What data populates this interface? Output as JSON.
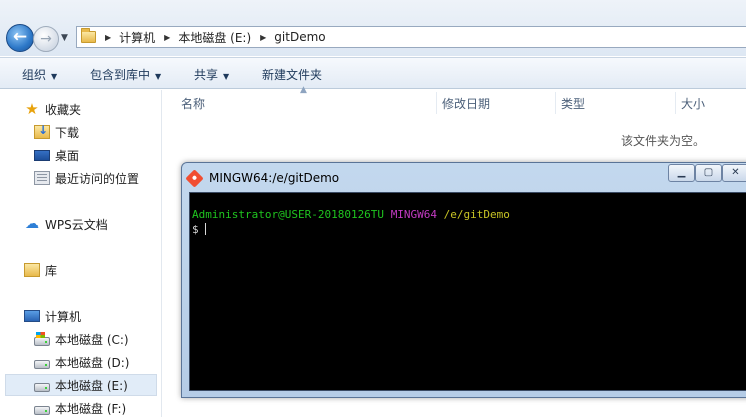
{
  "address": {
    "crumbs": [
      "计算机",
      "本地磁盘 (E:)",
      "gitDemo"
    ]
  },
  "toolbar": {
    "organize": "组织",
    "include_in_library": "包含到库中",
    "share": "共享",
    "new_folder": "新建文件夹"
  },
  "nav": {
    "favorites": "收藏夹",
    "downloads": "下载",
    "desktop": "桌面",
    "recent": "最近访问的位置",
    "wps_cloud": "WPS云文档",
    "libraries": "库",
    "computer": "计算机",
    "drive_c": "本地磁盘 (C:)",
    "drive_d": "本地磁盘 (D:)",
    "drive_e": "本地磁盘 (E:)",
    "drive_f": "本地磁盘 (F:)"
  },
  "file_list": {
    "columns": [
      "名称",
      "修改日期",
      "类型",
      "大小"
    ],
    "empty_message": "该文件夹为空。"
  },
  "terminal": {
    "title": "MINGW64:/e/gitDemo",
    "prompt_user": "Administrator@USER-20180126TU",
    "prompt_env": "MINGW64",
    "prompt_path": "/e/gitDemo",
    "prompt_symbol": "$",
    "colors": {
      "user": "#1fc41f",
      "env": "#c33bc3",
      "path": "#c8c425",
      "background": "#000000"
    }
  }
}
